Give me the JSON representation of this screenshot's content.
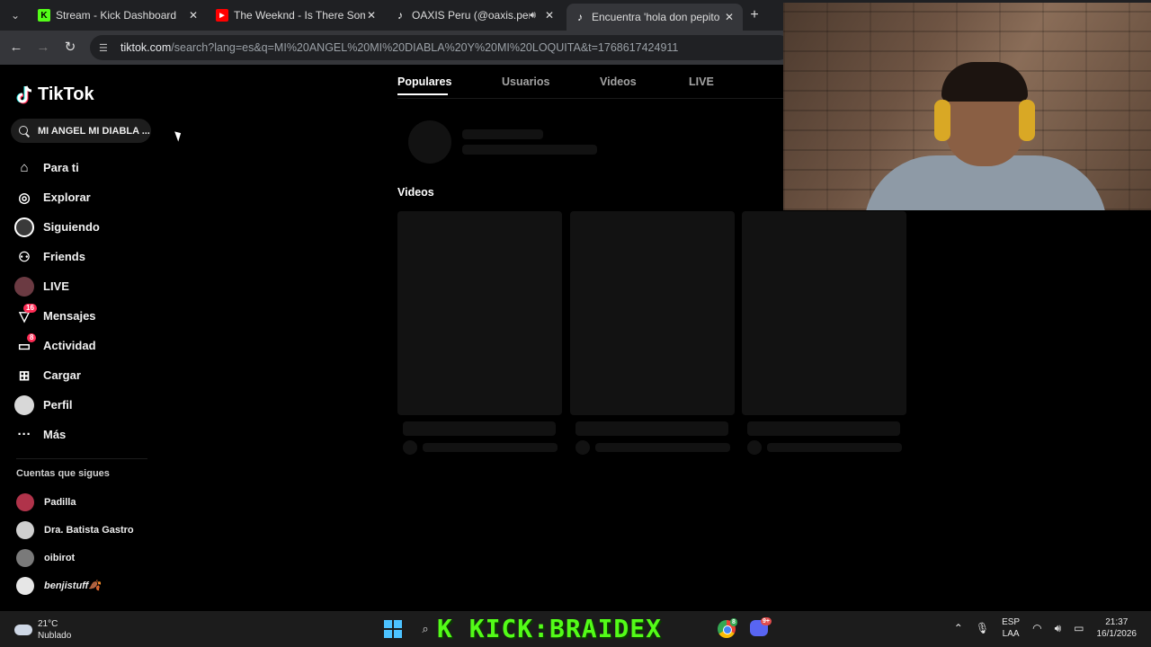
{
  "browser": {
    "tabs": [
      {
        "title": "Stream - Kick Dashboard",
        "favicon": "kick-icon",
        "favicon_letter": "K",
        "favicon_color": "#53fc18",
        "active": false
      },
      {
        "title": "The Weeknd - Is There Someone",
        "favicon": "youtube-icon",
        "favicon_color": "#ff0000",
        "active": false
      },
      {
        "title": "OAXIS Peru (@oaxis.peru) en",
        "favicon": "tiktok-icon",
        "audio": true,
        "active": false
      },
      {
        "title": "Encuentra 'hola don pepito tuto",
        "favicon": "tiktok-icon",
        "active": true
      }
    ],
    "url_host": "tiktok.com",
    "url_path": "/search?lang=es&q=MI%20ANGEL%20MI%20DIABLA%20Y%20MI%20LOQUITA&t=1768617424911"
  },
  "sidebar": {
    "brand": "TikTok",
    "search_value": "MI ANGEL MI DIABLA ...",
    "nav": [
      {
        "label": "Para ti",
        "icon": "home-icon",
        "glyph": "⌂"
      },
      {
        "label": "Explorar",
        "icon": "compass-icon",
        "glyph": "◎"
      },
      {
        "label": "Siguiendo",
        "icon": "following-avatar-icon",
        "glyph": ""
      },
      {
        "label": "Friends",
        "icon": "friends-icon",
        "glyph": "⚇"
      },
      {
        "label": "LIVE",
        "icon": "live-avatar-icon",
        "glyph": ""
      },
      {
        "label": "Mensajes",
        "icon": "messages-icon",
        "glyph": "▽",
        "badge": "16"
      },
      {
        "label": "Actividad",
        "icon": "activity-icon",
        "glyph": "▭",
        "badge": "8"
      },
      {
        "label": "Cargar",
        "icon": "upload-icon",
        "glyph": "⊞"
      },
      {
        "label": "Perfil",
        "icon": "profile-avatar-icon",
        "glyph": ""
      },
      {
        "label": "Más",
        "icon": "more-icon",
        "glyph": "···"
      }
    ],
    "following_title": "Cuentas que sigues",
    "following": [
      {
        "name": "Padilla",
        "color": "#b0334a"
      },
      {
        "name": "Dra. Batista Gastro",
        "color": "#cfcfcf"
      },
      {
        "name": "oibirot",
        "color": "#7a7a7a"
      },
      {
        "name": "benjistuff🍂",
        "color": "#e6e6e6"
      }
    ]
  },
  "main": {
    "tabs": [
      "Populares",
      "Usuarios",
      "Videos",
      "LIVE"
    ],
    "active_tab": "Populares",
    "videos_heading": "Videos"
  },
  "taskbar": {
    "weather_temp": "21°C",
    "weather_desc": "Nublado",
    "banner": "K KICK:BRAIDEX",
    "discord_badge": "9+",
    "chrome_badge": "8",
    "lang_top": "ESP",
    "lang_bottom": "LAA",
    "time": "21:37",
    "date": "16/1/2026"
  },
  "colors": {
    "accent": "#fe2c55",
    "kick_green": "#53fc18",
    "background": "#000000"
  }
}
